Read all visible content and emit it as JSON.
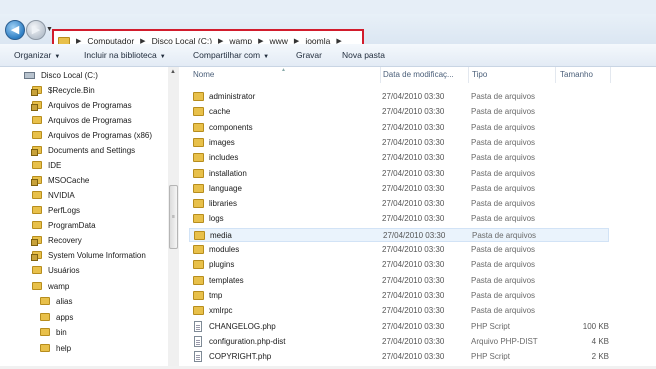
{
  "breadcrumb": [
    "Computador",
    "Disco Local (C:)",
    "wamp",
    "www",
    "joomla"
  ],
  "toolbar": {
    "organize": "Organizar",
    "include": "Incluir na biblioteca",
    "share": "Compartilhar com",
    "burn": "Gravar",
    "newfolder": "Nova pasta"
  },
  "columns": {
    "name": "Nome",
    "date": "Data de modificaç...",
    "type": "Tipo",
    "size": "Tamanho"
  },
  "nav": {
    "drive": "Disco Local (C:)",
    "items": [
      "$Recycle.Bin",
      "Arquivos de Programas",
      "Arquivos de Programas",
      "Arquivos de Programas (x86)",
      "Documents and Settings",
      "IDE",
      "MSOCache",
      "NVIDIA",
      "PerfLogs",
      "ProgramData",
      "Recovery",
      "System Volume Information",
      "Usuários",
      "wamp"
    ],
    "subitems": [
      "alias",
      "apps",
      "bin",
      "help"
    ]
  },
  "files": [
    {
      "name": "administrator",
      "date": "27/04/2010 03:30",
      "type": "Pasta de arquivos",
      "size": ""
    },
    {
      "name": "cache",
      "date": "27/04/2010 03:30",
      "type": "Pasta de arquivos",
      "size": ""
    },
    {
      "name": "components",
      "date": "27/04/2010 03:30",
      "type": "Pasta de arquivos",
      "size": ""
    },
    {
      "name": "images",
      "date": "27/04/2010 03:30",
      "type": "Pasta de arquivos",
      "size": ""
    },
    {
      "name": "includes",
      "date": "27/04/2010 03:30",
      "type": "Pasta de arquivos",
      "size": ""
    },
    {
      "name": "installation",
      "date": "27/04/2010 03:30",
      "type": "Pasta de arquivos",
      "size": ""
    },
    {
      "name": "language",
      "date": "27/04/2010 03:30",
      "type": "Pasta de arquivos",
      "size": ""
    },
    {
      "name": "libraries",
      "date": "27/04/2010 03:30",
      "type": "Pasta de arquivos",
      "size": ""
    },
    {
      "name": "logs",
      "date": "27/04/2010 03:30",
      "type": "Pasta de arquivos",
      "size": ""
    },
    {
      "name": "media",
      "date": "27/04/2010 03:30",
      "type": "Pasta de arquivos",
      "size": ""
    },
    {
      "name": "modules",
      "date": "27/04/2010 03:30",
      "type": "Pasta de arquivos",
      "size": ""
    },
    {
      "name": "plugins",
      "date": "27/04/2010 03:30",
      "type": "Pasta de arquivos",
      "size": ""
    },
    {
      "name": "templates",
      "date": "27/04/2010 03:30",
      "type": "Pasta de arquivos",
      "size": ""
    },
    {
      "name": "tmp",
      "date": "27/04/2010 03:30",
      "type": "Pasta de arquivos",
      "size": ""
    },
    {
      "name": "xmlrpc",
      "date": "27/04/2010 03:30",
      "type": "Pasta de arquivos",
      "size": ""
    },
    {
      "name": "CHANGELOG.php",
      "date": "27/04/2010 03:30",
      "type": "PHP Script",
      "size": "100 KB"
    },
    {
      "name": "configuration.php-dist",
      "date": "27/04/2010 03:30",
      "type": "Arquivo PHP-DIST",
      "size": "4 KB"
    },
    {
      "name": "COPYRIGHT.php",
      "date": "27/04/2010 03:30",
      "type": "PHP Script",
      "size": "2 KB"
    }
  ],
  "highlight_color": "#d21c2c"
}
